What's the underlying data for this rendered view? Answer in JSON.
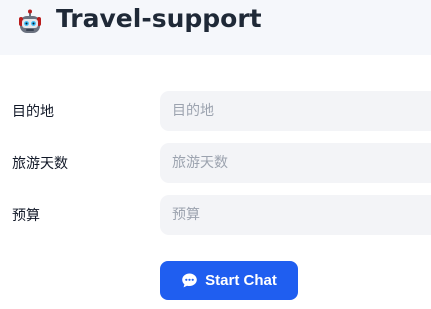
{
  "header": {
    "title": "Travel-support",
    "logo_icon": "robot-icon"
  },
  "form": {
    "fields": [
      {
        "label": "目的地",
        "placeholder": "目的地",
        "value": ""
      },
      {
        "label": "旅游天数",
        "placeholder": "旅游天数",
        "value": ""
      },
      {
        "label": "预算",
        "placeholder": "预算",
        "value": ""
      }
    ],
    "submit": {
      "label": "Start Chat",
      "icon": "chat-bubble-icon"
    }
  },
  "colors": {
    "header_bg": "#f5f7fb",
    "input_bg": "#f3f4f7",
    "button_bg": "#1f5ef0",
    "placeholder": "#9ca3af"
  }
}
